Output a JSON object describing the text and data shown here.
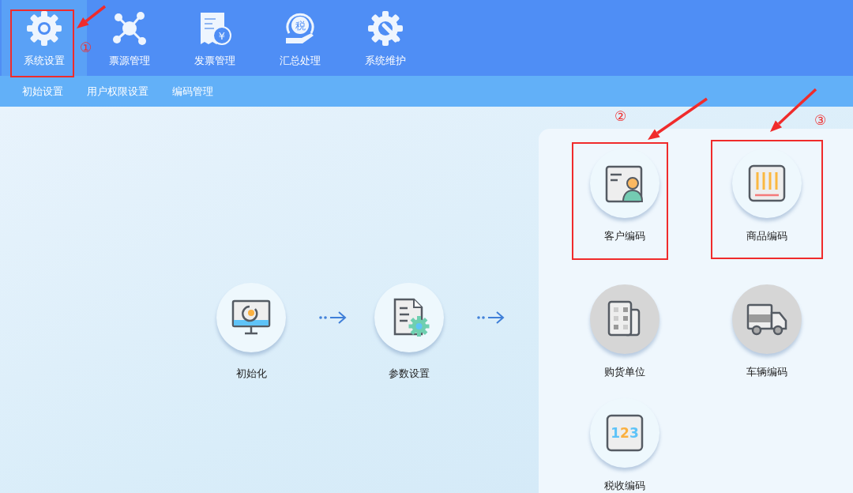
{
  "nav": {
    "tabs": [
      {
        "label": "系统设置",
        "selected": true,
        "kind": "gear"
      },
      {
        "label": "票源管理",
        "selected": false,
        "kind": "network"
      },
      {
        "label": "发票管理",
        "selected": false,
        "kind": "receipt",
        "icon_text": "¥"
      },
      {
        "label": "汇总处理",
        "selected": false,
        "kind": "tax-hand",
        "icon_text": "税"
      },
      {
        "label": "系统维护",
        "selected": false,
        "kind": "gear-wrench"
      }
    ]
  },
  "subnav": [
    "初始设置",
    "用户权限设置",
    "编码管理"
  ],
  "flow": [
    {
      "label": "初始化",
      "kind": "monitor"
    },
    {
      "label": "参数设置",
      "kind": "document-gear"
    }
  ],
  "panel": {
    "items": [
      {
        "label": "客户编码",
        "kind": "contact-card",
        "disabled": false
      },
      {
        "label": "商品编码",
        "kind": "barcode",
        "disabled": false
      },
      {
        "label": "购货单位",
        "kind": "buildings",
        "disabled": true
      },
      {
        "label": "车辆编码",
        "kind": "truck",
        "disabled": true
      },
      {
        "label": "税收编码",
        "kind": "number-box",
        "icon_text": "123",
        "disabled": false
      }
    ]
  },
  "annotations": [
    {
      "number": "①"
    },
    {
      "number": "②"
    },
    {
      "number": "③"
    }
  ]
}
